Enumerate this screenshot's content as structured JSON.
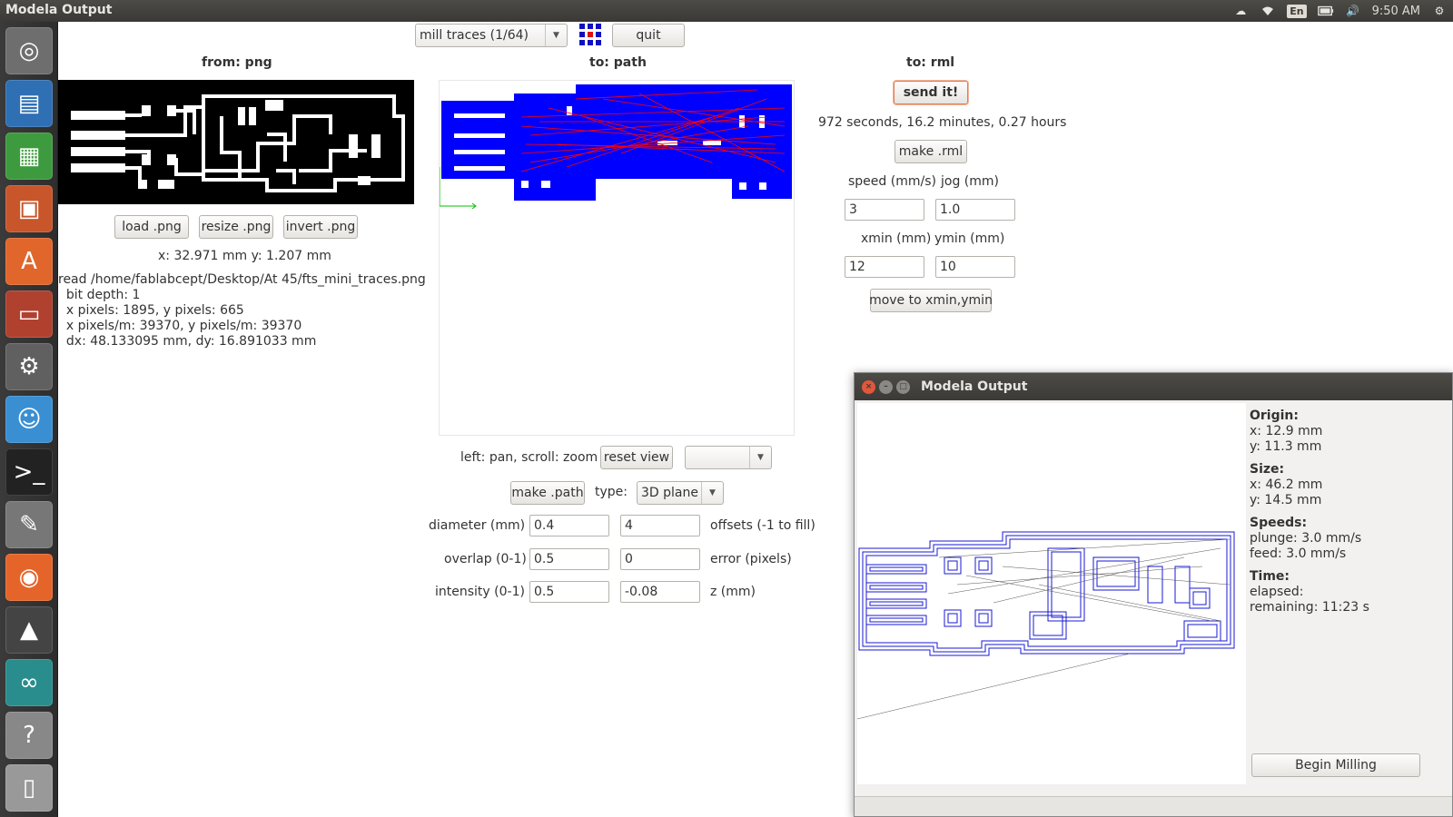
{
  "topbar": {
    "title": "Modela Output",
    "lang": "En",
    "time": "9:50 AM"
  },
  "app": {
    "process_select": "mill traces (1/64)",
    "quit_label": "quit",
    "from_header": "from: png",
    "to_path_header": "to: path",
    "to_rml_header": "to: rml",
    "load_png": "load .png",
    "resize_png": "resize .png",
    "invert_png": "invert .png",
    "coords": "x: 32.971 mm  y: 1.207 mm",
    "file_info": [
      "read /home/fablabcept/Desktop/At 45/fts_mini_traces.png",
      "  bit depth: 1",
      "  x pixels: 1895, y pixels: 665",
      "  x pixels/m: 39370, y pixels/m: 39370",
      "  dx: 48.133095 mm, dy: 16.891033 mm"
    ],
    "view_hint": "left: pan, scroll: zoom",
    "reset_view": "reset view",
    "view_select": "",
    "make_path": "make .path",
    "type_label": "type:",
    "type_select": "3D plane",
    "diameter_label": "diameter (mm)",
    "diameter_value": "0.4",
    "offsets_value": "4",
    "offsets_label": "offsets (-1 to fill)",
    "overlap_label": "overlap (0-1)",
    "overlap_value": "0.5",
    "error_value": "0",
    "error_label": "error (pixels)",
    "intensity_label": "intensity (0-1)",
    "intensity_value": "0.5",
    "z_value": "-0.08",
    "z_label": "z (mm)",
    "send_it": "send it!",
    "time_estimate": "972 seconds, 16.2 minutes, 0.27 hours",
    "make_rml": "make .rml",
    "speed_label": "speed (mm/s)",
    "jog_label": "jog (mm)",
    "speed_value": "3",
    "jog_value": "1.0",
    "xmin_label": "xmin (mm)",
    "ymin_label": "ymin (mm)",
    "xmin_value": "12",
    "ymin_value": "10",
    "move_xy": "move to xmin,ymin"
  },
  "dialog": {
    "title": "Modela Output",
    "origin_h": "Origin:",
    "origin_x": "x: 12.9 mm",
    "origin_y": "y: 11.3 mm",
    "size_h": "Size:",
    "size_x": "x: 46.2 mm",
    "size_y": "y: 14.5 mm",
    "speeds_h": "Speeds:",
    "plunge": "plunge: 3.0 mm/s",
    "feed": "feed: 3.0 mm/s",
    "time_h": "Time:",
    "elapsed": "elapsed:",
    "remaining": "remaining: 11:23 s",
    "begin": "Begin Milling"
  },
  "colors": {
    "path_fill": "#0000ff",
    "path_line": "#ff0000",
    "toolpath": "#1a1ad6",
    "send_border": "#e07b53"
  }
}
